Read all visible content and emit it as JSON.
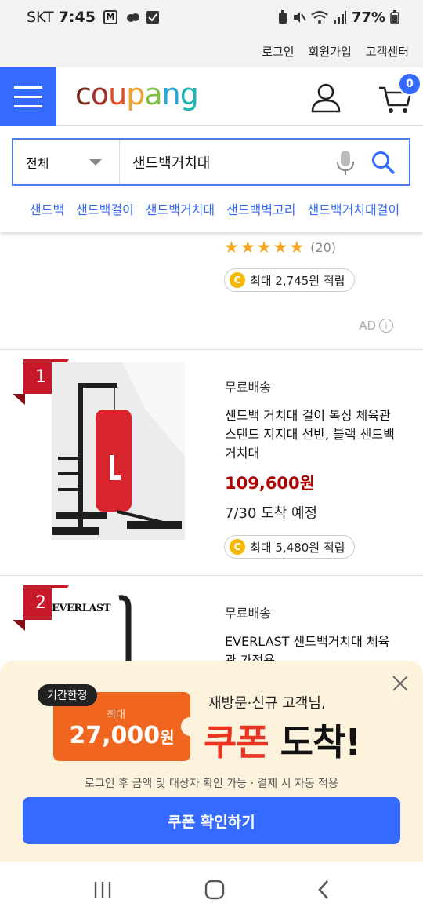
{
  "status_bar": {
    "carrier": "SKT",
    "time": "7:45",
    "battery": "77%"
  },
  "util_links": [
    "로그인",
    "회원가입",
    "고객센터"
  ],
  "header": {
    "logo_parts": [
      "c",
      "o",
      "u",
      "p",
      "a",
      "n",
      "g"
    ],
    "cart_count": "0"
  },
  "search": {
    "category": "전체",
    "query": "샌드백거치대",
    "suggestions": [
      "샌드백",
      "샌드백걸이",
      "샌드백거치대",
      "샌드백벽고리",
      "샌드백거치대걸이"
    ]
  },
  "product_top": {
    "review_count": "(20)",
    "reward": "최대 2,745원 적립",
    "ad_label": "AD"
  },
  "products": [
    {
      "rank": "1",
      "shipping": "무료배송",
      "name": "샌드백 거치대 걸이 복싱 체육관 스탠드 지지대 선반, 블랙 샌드백 거치대",
      "price": "109,600원",
      "arrival": "7/30 도착 예정",
      "reward": "최대 5,480원 적립"
    },
    {
      "rank": "2",
      "shipping": "무료배송",
      "name": "EVERLAST 샌드백거치대 체육관 가정용",
      "brand_logo": "EVERLAST"
    }
  ],
  "coupon": {
    "limited_tag": "기간한정",
    "max_label": "최대",
    "amount": "27,000",
    "amount_unit": "원",
    "sub": "재방문·신규 고객님,",
    "headline_red": "쿠폰",
    "headline_black": "도착!",
    "note": "로그인 후 금액 및 대상자 확인 가능 · 결제 시 자동 적용",
    "button": "쿠폰 확인하기"
  },
  "colors": {
    "accent": "#346aff",
    "price": "#ae0000",
    "coupon_orange": "#f0661f",
    "coupon_bg": "#fdf2dc",
    "rank_red": "#c8192a"
  }
}
